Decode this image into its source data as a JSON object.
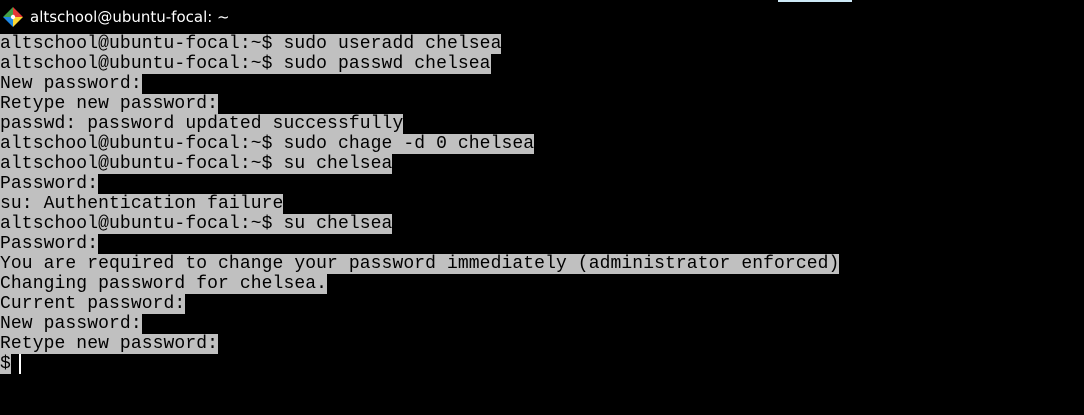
{
  "window": {
    "title": "altschool@ubuntu-focal: ~",
    "icon": "git-bash-icon"
  },
  "colors": {
    "background": "#000000",
    "selection_background": "#c0c0c0",
    "selected_text": "#000000",
    "title_text": "#ffffff",
    "title_accent": "#cde8f6",
    "icon_red": "#e53935",
    "icon_green": "#43a047",
    "icon_blue": "#1e88e5",
    "icon_yellow": "#fdd835"
  },
  "terminal": {
    "lines": [
      "altschool@ubuntu-focal:~$ sudo useradd chelsea",
      "altschool@ubuntu-focal:~$ sudo passwd chelsea",
      "New password:",
      "Retype new password:",
      "passwd: password updated successfully",
      "altschool@ubuntu-focal:~$ sudo chage -d 0 chelsea",
      "altschool@ubuntu-focal:~$ su chelsea",
      "Password:",
      "su: Authentication failure",
      "altschool@ubuntu-focal:~$ su chelsea",
      "Password:",
      "You are required to change your password immediately (administrator enforced)",
      "Changing password for chelsea.",
      "Current password:",
      "New password:",
      "Retype new password:",
      "$"
    ]
  }
}
